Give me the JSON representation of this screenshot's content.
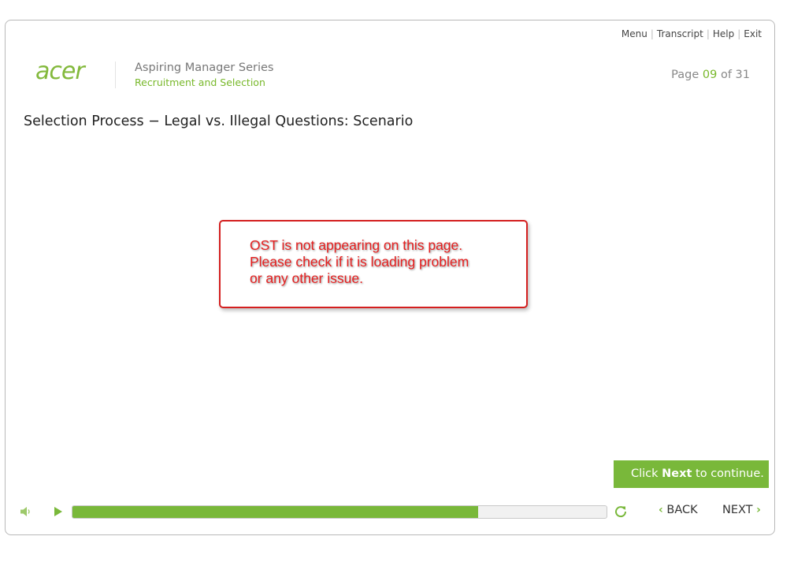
{
  "topnav": {
    "menu": "Menu",
    "transcript": "Transcript",
    "help": "Help",
    "exit": "Exit",
    "sep": "|"
  },
  "brand": {
    "logo_text": "acer",
    "series": "Aspiring Manager Series",
    "module": "Recruitment and Selection",
    "accent_color": "#78b82a"
  },
  "page": {
    "prefix": "Page",
    "current": "09",
    "of_label": "of",
    "total": "31"
  },
  "title": "Selection Process − Legal vs. Illegal Questions: Scenario",
  "note": {
    "line1": "OST is not appearing on this page.",
    "line2": "Please check if it is loading problem",
    "line3": "or any other issue.",
    "border_color": "#d41f1f"
  },
  "continue": {
    "pre": "Click",
    "bold": "Next",
    "post": "to continue."
  },
  "player": {
    "progress_fraction": 0.76,
    "back_label": "BACK",
    "next_label": "NEXT",
    "icons": [
      "volume-icon",
      "play-icon",
      "reload-icon"
    ]
  }
}
